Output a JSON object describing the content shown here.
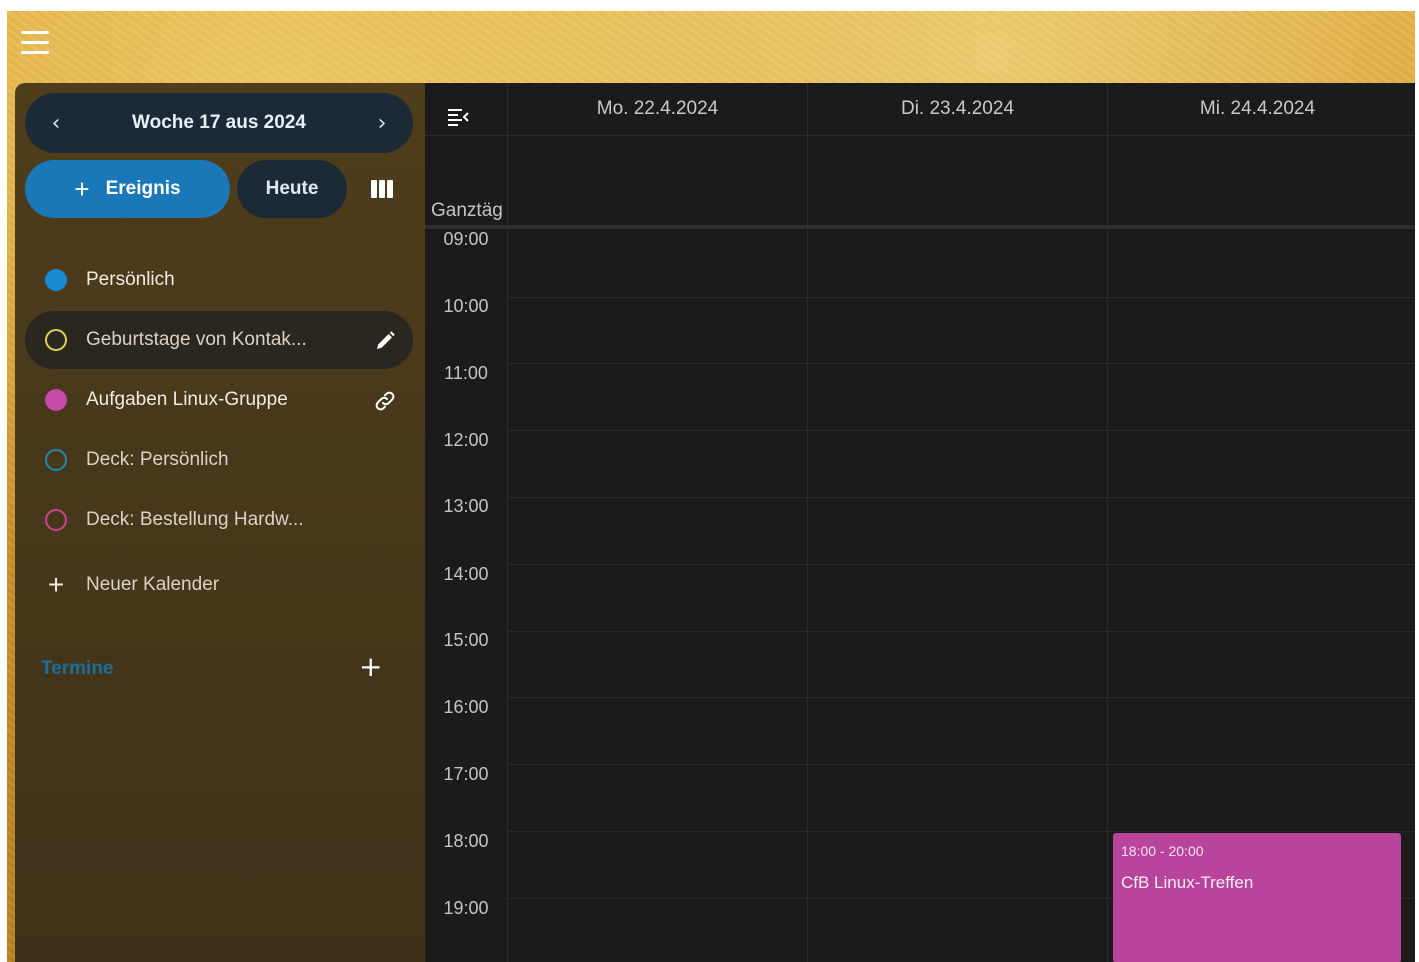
{
  "sidebar": {
    "week_label": "Woche 17 aus 2024",
    "prev_icon": "chevron-left-icon",
    "next_icon": "chevron-right-icon",
    "new_event_label": "Ereignis",
    "today_label": "Heute",
    "view_icon": "column-view-icon",
    "calendars": [
      {
        "label": "Persönlich",
        "color": "#1a8ad4",
        "style": "filled"
      },
      {
        "label": "Geburtstage von Kontak...",
        "color": "#e3cf5b",
        "style": "hollow",
        "action_icon": "pencil-icon"
      },
      {
        "label": "Aufgaben Linux-Gruppe",
        "color": "#c54aa8",
        "style": "filled",
        "action_icon": "link-icon"
      },
      {
        "label": "Deck: Persönlich",
        "color": "#2187a8",
        "style": "hollow"
      },
      {
        "label": "Deck: Bestellung Hardw...",
        "color": "#c4478f",
        "style": "hollow"
      }
    ],
    "new_calendar_label": "Neuer Kalender",
    "appointments_label": "Termine"
  },
  "main": {
    "days": [
      "Mo. 22.4.2024",
      "Di. 23.4.2024",
      "Mi. 24.4.2024"
    ],
    "allday_label": "Ganztäg",
    "hours": [
      "09:00",
      "10:00",
      "11:00",
      "12:00",
      "13:00",
      "14:00",
      "15:00",
      "16:00",
      "17:00",
      "18:00",
      "19:00"
    ],
    "events": [
      {
        "time": "18:00 - 20:00",
        "title": "CfB Linux-Treffen",
        "color": "#b8449c",
        "day": "Mi. 24.4.2024"
      }
    ]
  }
}
